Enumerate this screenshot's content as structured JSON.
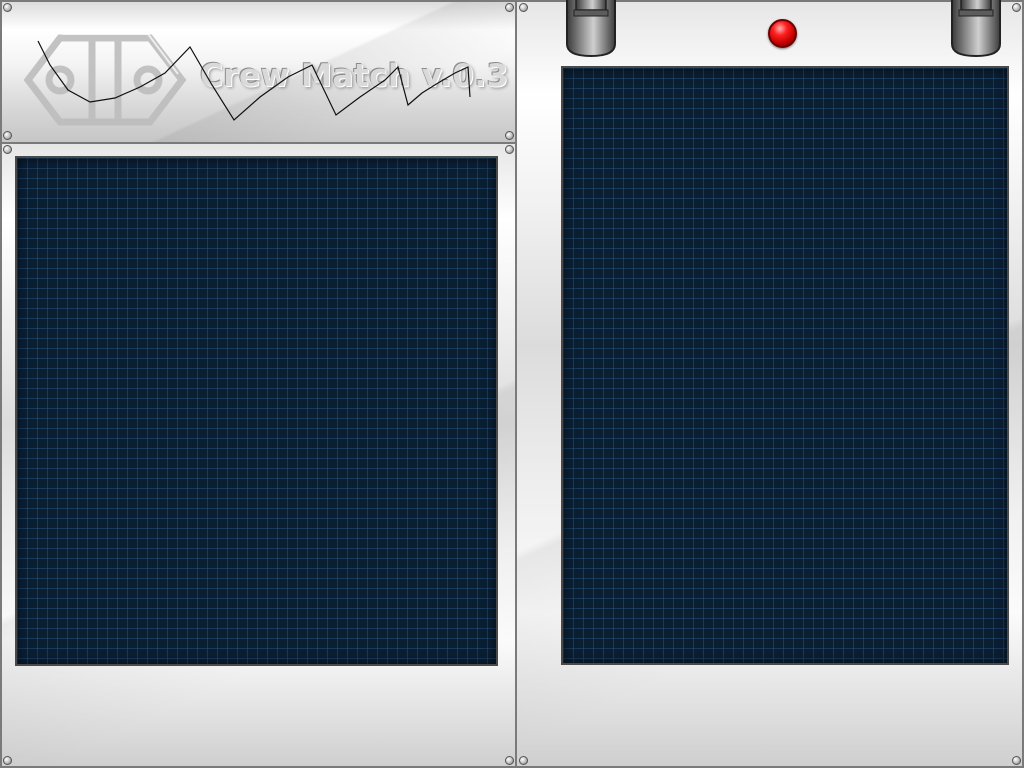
{
  "app": {
    "title": "Crew Match v.0.3"
  },
  "colors": {
    "screen_background": "#0b1f33",
    "grid_line": "#285a8c",
    "panel_metal": "#e6e6e6",
    "indicator_red": "#e00000"
  },
  "icons": {
    "logo": "crew-logo-icon",
    "indicator": "red-indicator-light",
    "pipes": "metal-pipe-icon",
    "screws": "screw-icon"
  }
}
